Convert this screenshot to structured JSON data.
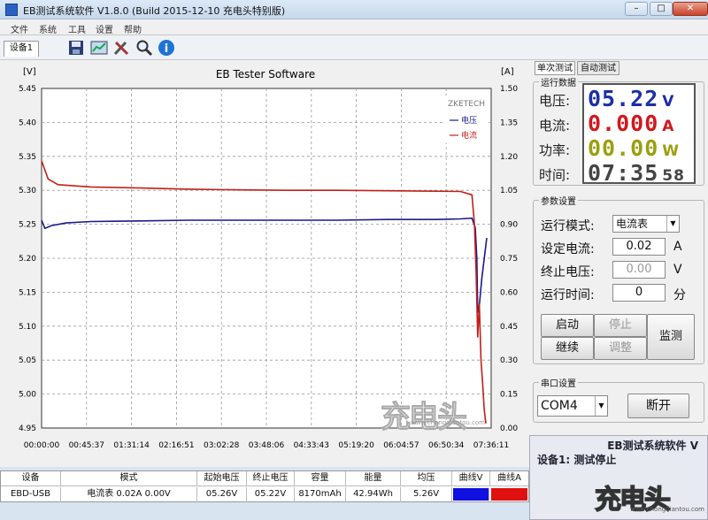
{
  "window": {
    "title": "EB测试系统软件 V1.8.0 (Build 2015-12-10 充电头特别版)"
  },
  "menu": [
    "文件",
    "系统",
    "工具",
    "设置",
    "帮助"
  ],
  "toolbar": {
    "device_tab": "设备1"
  },
  "chart_data": {
    "type": "line",
    "title": "EB Tester Software",
    "watermark": "ZKETECH",
    "left_unit": "[V]",
    "right_unit": "[A]",
    "ylim_left": [
      4.95,
      5.45
    ],
    "ylim_right": [
      0.0,
      1.5
    ],
    "y_ticks_left": [
      "5.45",
      "5.40",
      "5.35",
      "5.30",
      "5.25",
      "5.20",
      "5.15",
      "5.10",
      "5.05",
      "5.00",
      "4.95"
    ],
    "y_ticks_right": [
      "1.50",
      "1.35",
      "1.20",
      "1.05",
      "0.90",
      "0.75",
      "0.60",
      "0.45",
      "0.30",
      "0.15",
      "0.00"
    ],
    "x_ticks": [
      "00:00:00",
      "00:45:37",
      "01:31:14",
      "02:16:51",
      "03:02:28",
      "03:48:06",
      "04:33:43",
      "05:19:20",
      "06:04:57",
      "06:50:34",
      "07:36:11"
    ],
    "xlim_seconds": [
      0,
      27371
    ],
    "legend": [
      {
        "name": "电压",
        "color": "#1a1a8c"
      },
      {
        "name": "电流",
        "color": "#c0201a"
      }
    ],
    "series": [
      {
        "name": "电压",
        "axis": "left",
        "color": "#1a1a8c",
        "points": [
          [
            0,
            5.256
          ],
          [
            200,
            5.244
          ],
          [
            600,
            5.248
          ],
          [
            1500,
            5.252
          ],
          [
            3000,
            5.254
          ],
          [
            6000,
            5.255
          ],
          [
            9000,
            5.256
          ],
          [
            12000,
            5.256
          ],
          [
            15000,
            5.256
          ],
          [
            18000,
            5.256
          ],
          [
            21000,
            5.257
          ],
          [
            24000,
            5.257
          ],
          [
            25500,
            5.258
          ],
          [
            26200,
            5.259
          ],
          [
            26400,
            5.245
          ],
          [
            26500,
            5.2
          ],
          [
            26550,
            5.12
          ],
          [
            26650,
            5.13
          ],
          [
            26800,
            5.17
          ],
          [
            26950,
            5.2
          ],
          [
            27100,
            5.23
          ]
        ]
      },
      {
        "name": "电流",
        "axis": "right",
        "color": "#c0201a",
        "points": [
          [
            0,
            1.18
          ],
          [
            150,
            1.15
          ],
          [
            400,
            1.1
          ],
          [
            1000,
            1.075
          ],
          [
            3000,
            1.065
          ],
          [
            6000,
            1.06
          ],
          [
            9000,
            1.055
          ],
          [
            12000,
            1.052
          ],
          [
            15000,
            1.05
          ],
          [
            18000,
            1.05
          ],
          [
            21000,
            1.048
          ],
          [
            24000,
            1.046
          ],
          [
            25500,
            1.045
          ],
          [
            26200,
            1.03
          ],
          [
            26350,
            0.9
          ],
          [
            26450,
            0.7
          ],
          [
            26550,
            0.4
          ],
          [
            26650,
            0.55
          ],
          [
            26750,
            0.3
          ],
          [
            26850,
            0.2
          ],
          [
            26950,
            0.08
          ],
          [
            27050,
            0.02
          ]
        ]
      }
    ]
  },
  "right_panel": {
    "tabs": [
      "单次测试",
      "自动测试"
    ],
    "run_data": {
      "title": "运行数据",
      "voltage_label": "电压:",
      "voltage_value": "05.22",
      "voltage_unit": "V",
      "voltage_color": "#1b2fa8",
      "current_label": "电流:",
      "current_value": "0.000",
      "current_unit": "A",
      "current_color": "#d0181e",
      "power_label": "功率:",
      "power_value": "00.00",
      "power_unit": "W",
      "power_color": "#9aa010",
      "time_label": "时间:",
      "time_value": "07:35",
      "time_seconds": "58",
      "time_color": "#444444"
    },
    "params": {
      "title": "参数设置",
      "mode_label": "运行模式:",
      "mode_value": "电流表",
      "current_label": "设定电流:",
      "current_value": "0.02",
      "current_unit": "A",
      "voltage_label": "终止电压:",
      "voltage_value": "0.00",
      "voltage_unit": "V",
      "time_label": "运行时间:",
      "time_value": "0",
      "time_unit": "分"
    },
    "buttons": {
      "start": "启动",
      "stop": "停止",
      "continue": "继续",
      "adjust": "调整",
      "monitor": "监测"
    },
    "serial": {
      "title": "串口设置",
      "port": "COM4",
      "disconnect": "断开"
    },
    "status": {
      "heading": "EB测试系统软件 V",
      "message": "设备1: 测试停止"
    }
  },
  "table": {
    "headers": [
      "设备",
      "模式",
      "起始电压",
      "终止电压",
      "容量",
      "能量",
      "均压",
      "曲线V",
      "曲线A"
    ],
    "row": [
      "EBD-USB",
      "电流表  0.02A  0.00V",
      "05.26V",
      "05.22V",
      "8170mAh",
      "42.94Wh",
      "5.26V",
      "",
      ""
    ],
    "curve_v_color": "#1010e0",
    "curve_a_color": "#e01010"
  },
  "watermark": {
    "brand": "充电头",
    "site": "www.chongdiantou.com"
  }
}
